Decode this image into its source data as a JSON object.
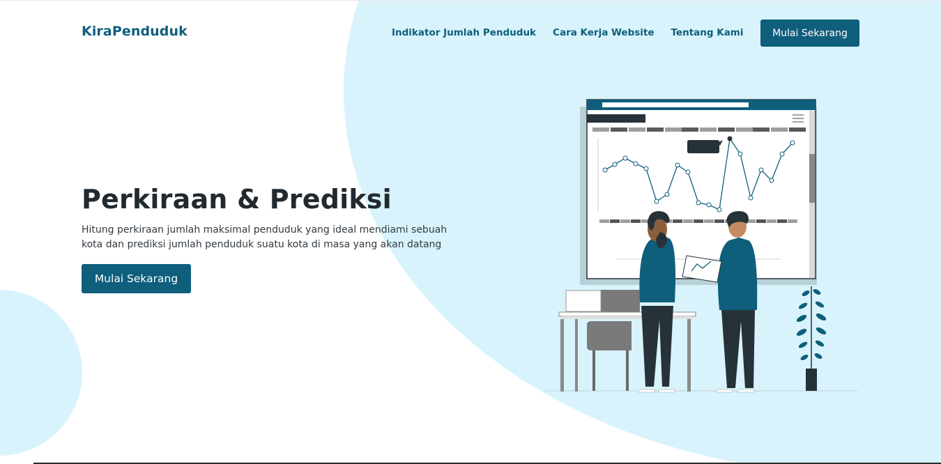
{
  "nav": {
    "brand": "KiraPenduduk",
    "links": [
      "Indikator Jumlah Penduduk",
      "Cara Kerja Website",
      "Tentang Kami"
    ],
    "cta_label": "Mulai Sekarang"
  },
  "hero": {
    "title": "Perkiraan & Prediksi",
    "description": "Hitung perkiraan jumlah maksimal penduduk yang ideal mendiami sebuah kota dan prediksi jumlah penduduk suatu kota di masa yang akan datang",
    "cta_label": "Mulai Sekarang"
  },
  "colors": {
    "brand": "#0e5e7c",
    "accent_bg": "#d8f3fb",
    "dark_text": "#222a30"
  },
  "illustration": {
    "name": "analytics-dashboard-illustration"
  }
}
